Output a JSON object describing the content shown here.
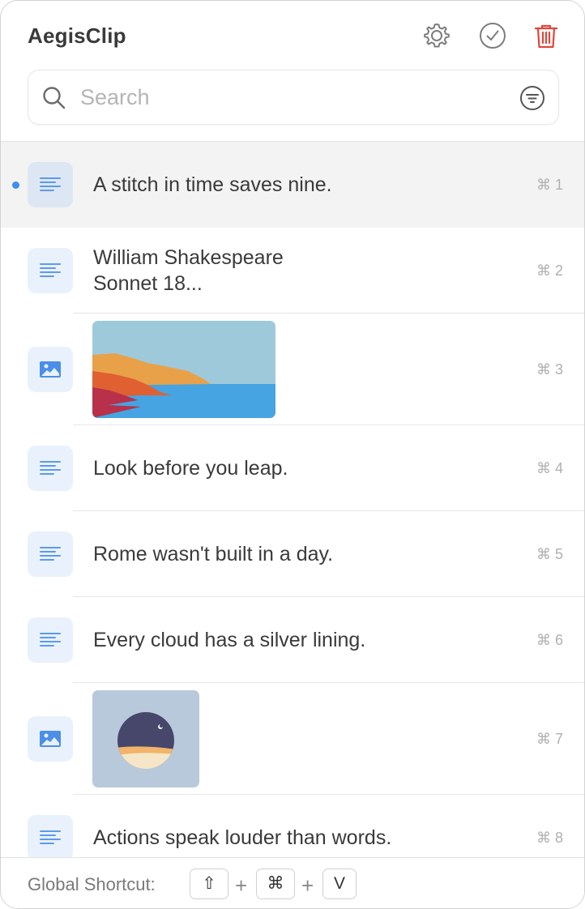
{
  "app": {
    "title": "AegisClip"
  },
  "header": {
    "settings_icon": "gear-icon",
    "check_icon": "checkmark-circle-icon",
    "trash_icon": "trash-icon",
    "trash_color": "#e0463c"
  },
  "search": {
    "placeholder": "Search",
    "value": ""
  },
  "clips": [
    {
      "type": "text",
      "lines": [
        "A stitch in time saves nine."
      ],
      "shortcut": "⌘ 1",
      "selected": true
    },
    {
      "type": "text",
      "lines": [
        "William Shakespeare",
        "Sonnet 18..."
      ],
      "shortcut": "⌘ 2",
      "selected": false
    },
    {
      "type": "image",
      "image": "coastal-landscape",
      "shortcut": "⌘ 3",
      "selected": false
    },
    {
      "type": "text",
      "lines": [
        "Look before you leap."
      ],
      "shortcut": "⌘ 4",
      "selected": false
    },
    {
      "type": "text",
      "lines": [
        "Rome wasn't built in a day."
      ],
      "shortcut": "⌘ 5",
      "selected": false
    },
    {
      "type": "text",
      "lines": [
        "Every cloud has a silver lining."
      ],
      "shortcut": "⌘ 6",
      "selected": false
    },
    {
      "type": "image",
      "image": "night-moon-circle",
      "shortcut": "⌘ 7",
      "selected": false
    },
    {
      "type": "text",
      "lines": [
        "Actions speak louder than words."
      ],
      "shortcut": "⌘ 8",
      "selected": false
    }
  ],
  "footer": {
    "label": "Global Shortcut:",
    "keys": [
      "⇧",
      "⌘",
      "V"
    ],
    "separator": "+"
  },
  "colors": {
    "accent": "#3d8ef0",
    "icon_tile": "#e9f1fc",
    "selected_row": "#f3f3f3"
  }
}
